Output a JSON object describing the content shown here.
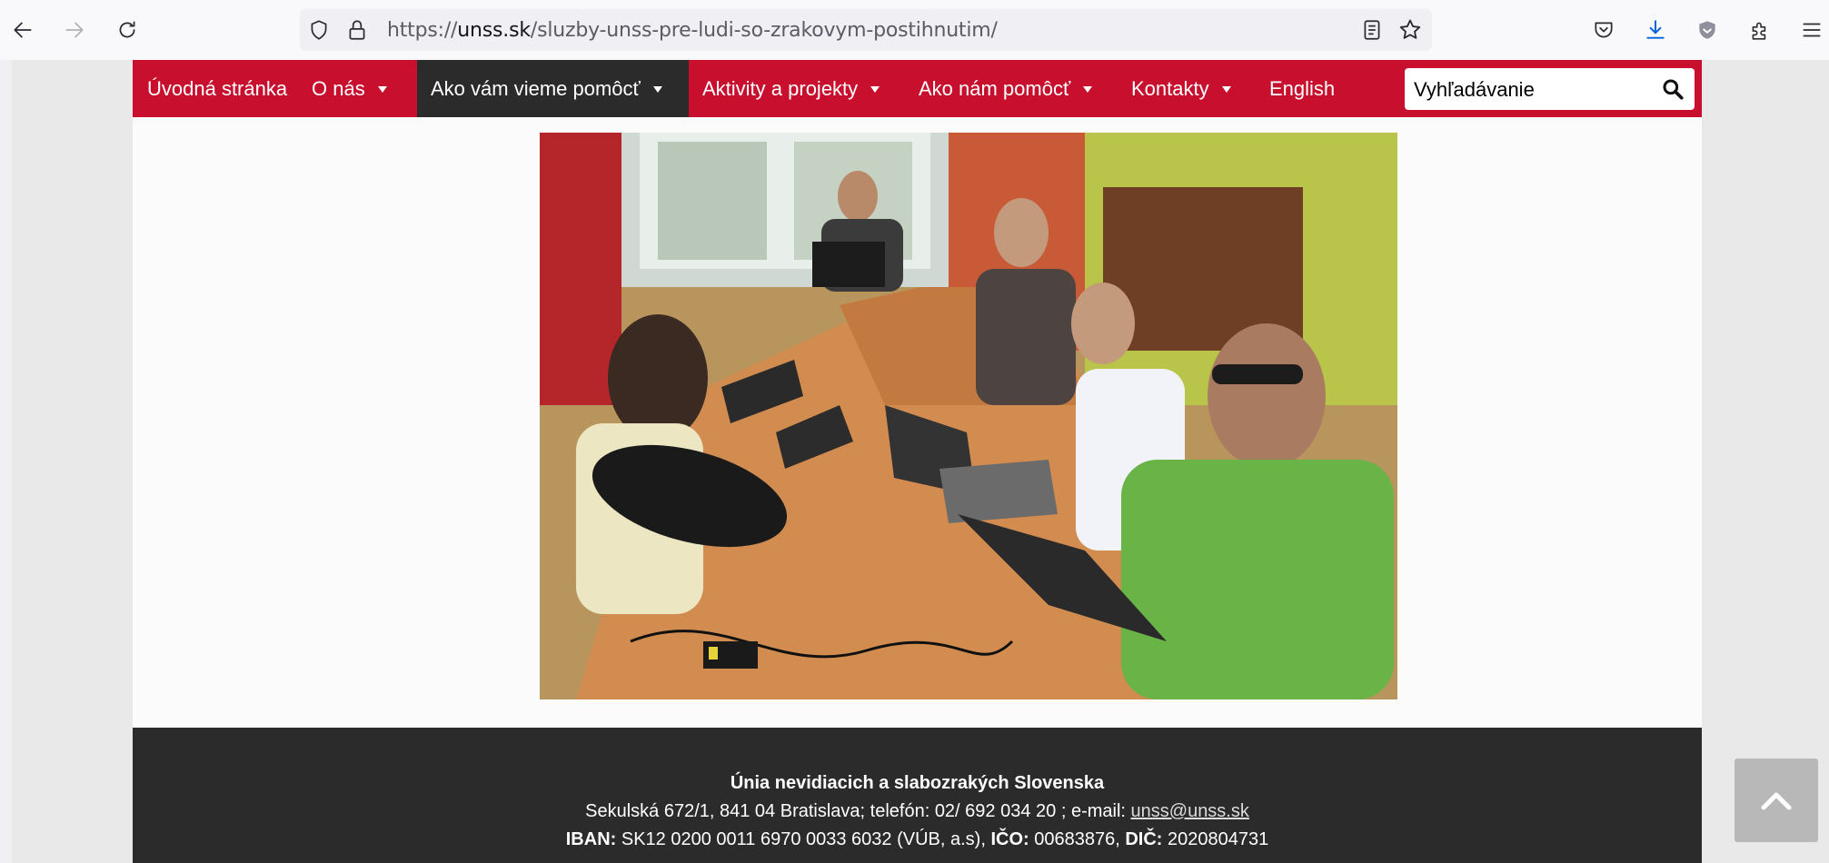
{
  "browser": {
    "url_prefix": "https://",
    "url_host": "unss.sk",
    "url_path": "/sluzby-unss-pre-ludi-so-zrakovym-postihnutim/"
  },
  "nav": {
    "items": [
      {
        "label": "Úvodná stránka",
        "has_dropdown": false,
        "active": false
      },
      {
        "label": "O nás",
        "has_dropdown": true,
        "active": false
      },
      {
        "label": "Ako vám vieme pomôcť",
        "has_dropdown": true,
        "active": true
      },
      {
        "label": "Aktivity a projekty",
        "has_dropdown": true,
        "active": false
      },
      {
        "label": "Ako nám pomôcť",
        "has_dropdown": true,
        "active": false
      },
      {
        "label": "Kontakty",
        "has_dropdown": true,
        "active": false
      },
      {
        "label": "English",
        "has_dropdown": false,
        "active": false
      }
    ],
    "search_placeholder": "Vyhľadávanie"
  },
  "footer": {
    "org_name": "Únia nevidiacich a slabozrakých Slovenska",
    "address_text": "Sekulská 672/1, 841 04 Bratislava; telefón: 02/ 692 034 20 ; e-mail: ",
    "email": "unss@unss.sk",
    "iban_label": "IBAN:",
    "iban_value": " SK12 0200 0011 6970 0033 6032 (VÚB, a.s), ",
    "ico_label": "IČO:",
    "ico_value": " 00683876, ",
    "dic_label": "DIČ:",
    "dic_value": " 2020804731"
  },
  "colors": {
    "nav_bg": "#c8102e",
    "nav_active_bg": "#2b2b2b",
    "footer_bg": "#2b2b2b",
    "download_icon": "#0060df"
  }
}
